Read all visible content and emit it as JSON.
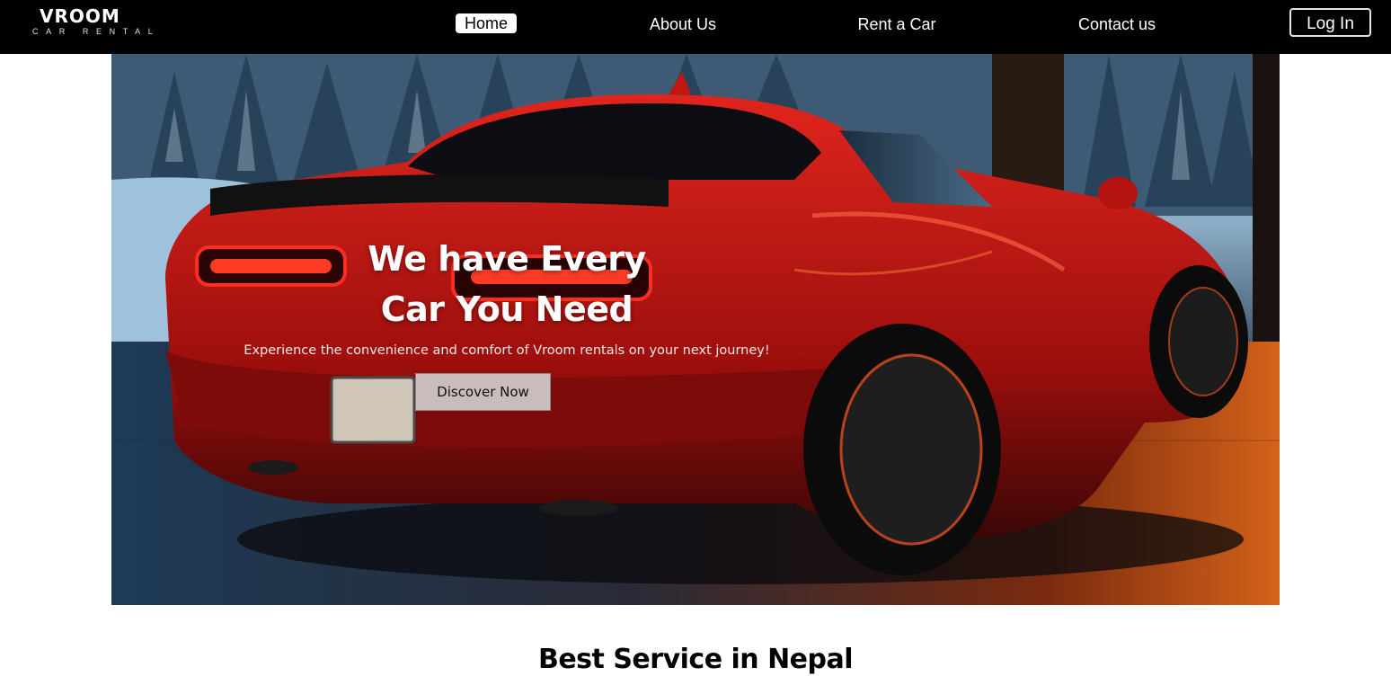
{
  "brand": {
    "name": "VROOM",
    "tagline": "CAR RENTAL"
  },
  "nav": {
    "items": [
      {
        "label": "Home",
        "active": true
      },
      {
        "label": "About Us",
        "active": false
      },
      {
        "label": "Rent a Car",
        "active": false
      },
      {
        "label": "Contact us",
        "active": false
      }
    ],
    "login_label": "Log In"
  },
  "hero": {
    "title_line1": "We have Every",
    "title_line2": "Car You Need",
    "subtitle": "Experience the convenience and comfort of Vroom rentals on your next journey!",
    "cta_label": "Discover Now"
  },
  "section": {
    "title": "Best Service in Nepal"
  },
  "colors": {
    "nav_bg": "#000000",
    "car_red": "#c1121f",
    "button_bg": "#c8bdbb",
    "text_dark": "#000000"
  }
}
